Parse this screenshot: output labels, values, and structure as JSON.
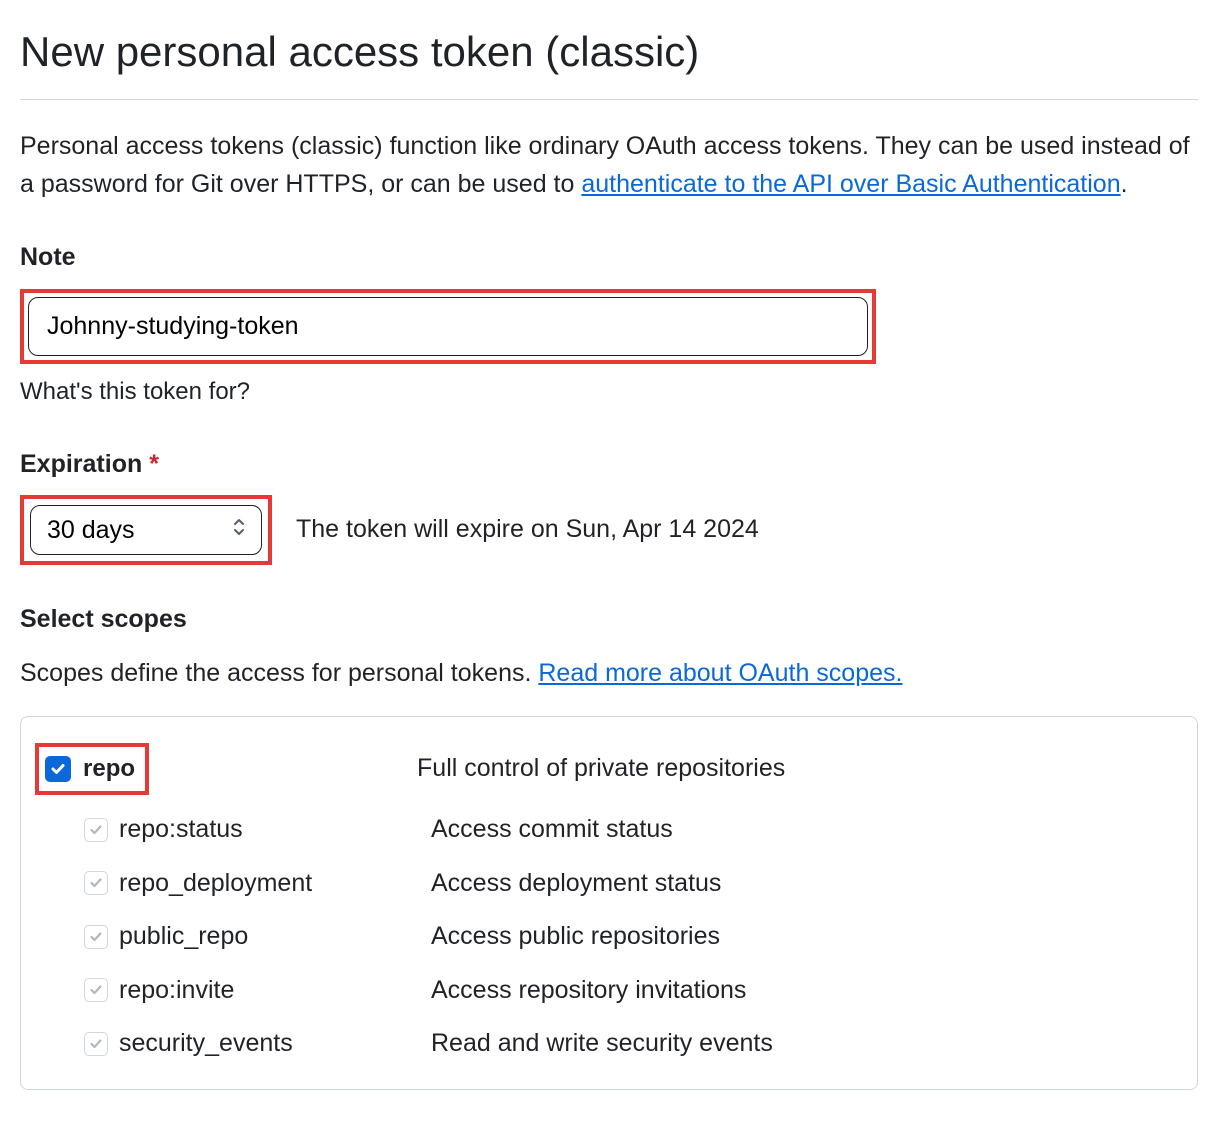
{
  "page_title": "New personal access token (classic)",
  "description_prefix": "Personal access tokens (classic) function like ordinary OAuth access tokens. They can be used instead of a password for Git over HTTPS, or can be used to ",
  "description_link": "authenticate to the API over Basic Authentication",
  "description_suffix": ".",
  "note": {
    "label": "Note",
    "value": "Johnny-studying-token",
    "hint": "What's this token for?"
  },
  "expiration": {
    "label": "Expiration",
    "value": "30 days",
    "info": "The token will expire on Sun, Apr 14 2024"
  },
  "scopes": {
    "heading": "Select scopes",
    "description_prefix": "Scopes define the access for personal tokens. ",
    "description_link": "Read more about OAuth scopes.",
    "items": [
      {
        "name": "repo",
        "desc": "Full control of private repositories",
        "checked": true,
        "bold": true
      },
      {
        "name": "repo:status",
        "desc": "Access commit status",
        "checked": true
      },
      {
        "name": "repo_deployment",
        "desc": "Access deployment status",
        "checked": true
      },
      {
        "name": "public_repo",
        "desc": "Access public repositories",
        "checked": true
      },
      {
        "name": "repo:invite",
        "desc": "Access repository invitations",
        "checked": true
      },
      {
        "name": "security_events",
        "desc": "Read and write security events",
        "checked": true
      }
    ]
  }
}
